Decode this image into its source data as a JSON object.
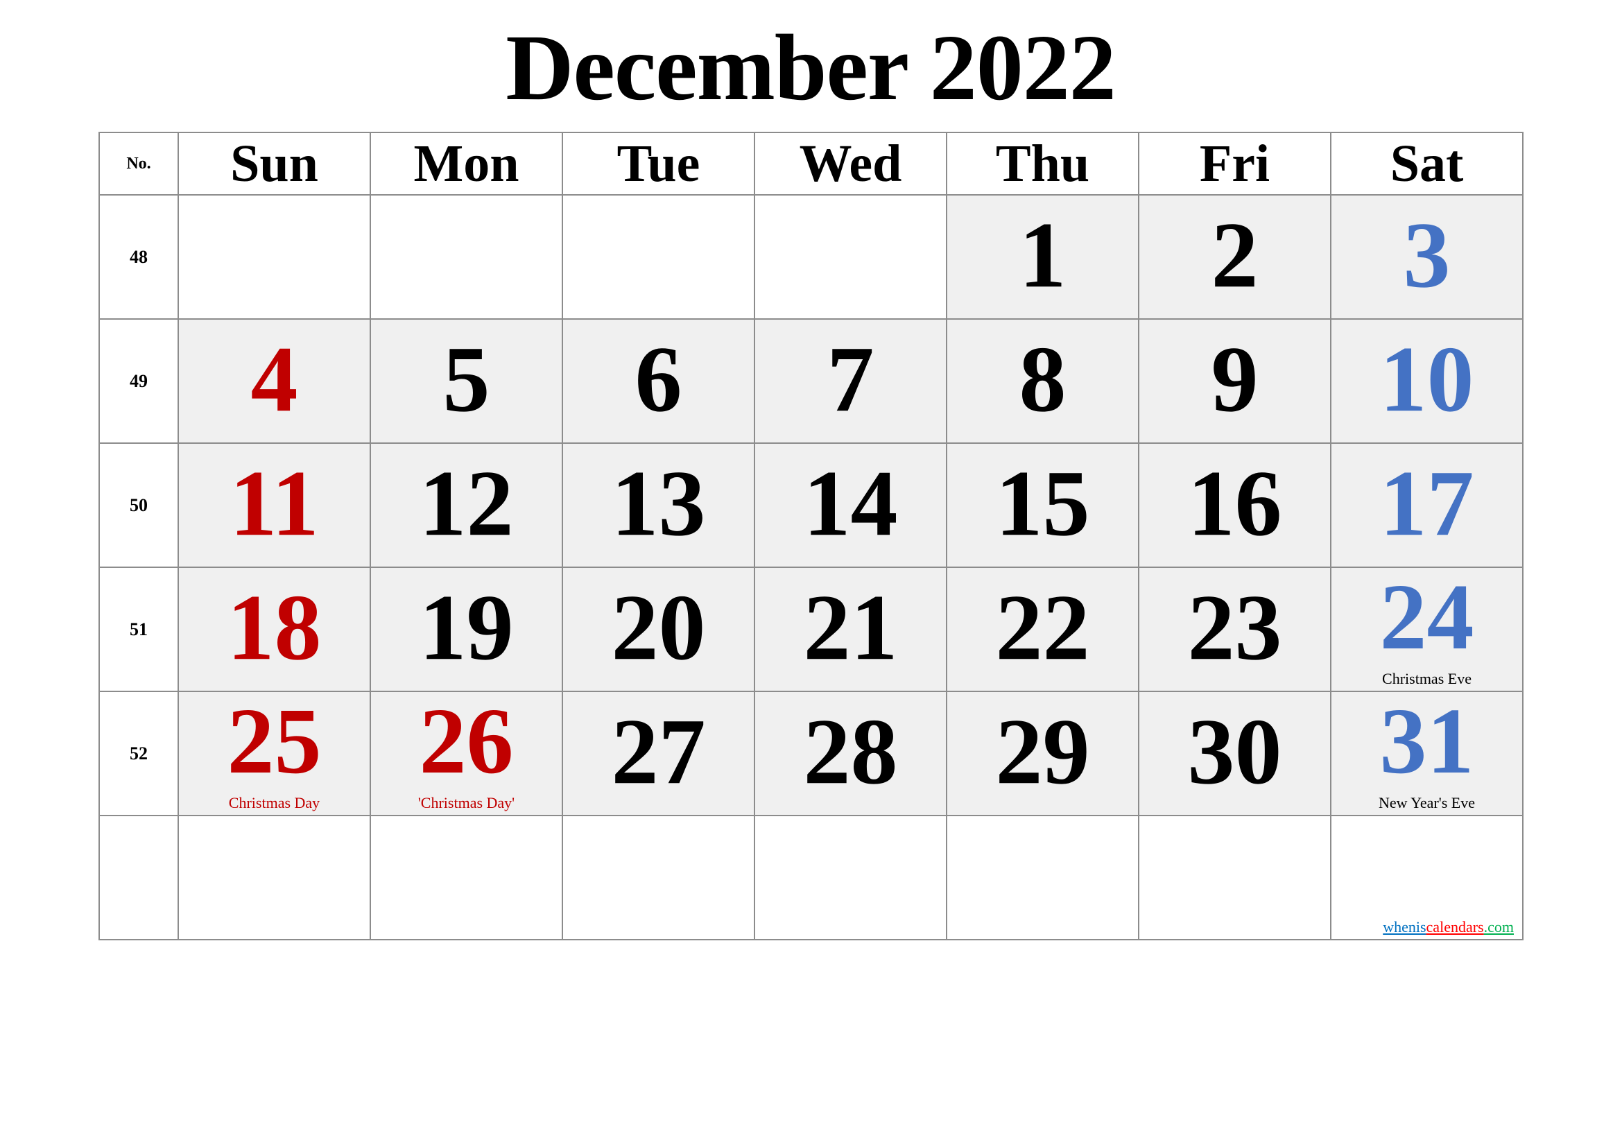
{
  "title": "December 2022",
  "header": {
    "week_no_label": "No.",
    "days": [
      "Sun",
      "Mon",
      "Tue",
      "Wed",
      "Thu",
      "Fri",
      "Sat"
    ]
  },
  "colors": {
    "sunday_holiday": "#C00000",
    "saturday": "#4472C4",
    "weekday": "#000000",
    "cell_fill": "#F0F0F0",
    "grid": "#8C8C8C"
  },
  "weeks": [
    {
      "no": "48",
      "days": [
        {
          "day": "",
          "color": "black",
          "holiday": ""
        },
        {
          "day": "",
          "color": "black",
          "holiday": ""
        },
        {
          "day": "",
          "color": "black",
          "holiday": ""
        },
        {
          "day": "",
          "color": "black",
          "holiday": ""
        },
        {
          "day": "1",
          "color": "black",
          "holiday": ""
        },
        {
          "day": "2",
          "color": "black",
          "holiday": ""
        },
        {
          "day": "3",
          "color": "blue",
          "holiday": ""
        }
      ]
    },
    {
      "no": "49",
      "days": [
        {
          "day": "4",
          "color": "red",
          "holiday": ""
        },
        {
          "day": "5",
          "color": "black",
          "holiday": ""
        },
        {
          "day": "6",
          "color": "black",
          "holiday": ""
        },
        {
          "day": "7",
          "color": "black",
          "holiday": ""
        },
        {
          "day": "8",
          "color": "black",
          "holiday": ""
        },
        {
          "day": "9",
          "color": "black",
          "holiday": ""
        },
        {
          "day": "10",
          "color": "blue",
          "holiday": ""
        }
      ]
    },
    {
      "no": "50",
      "days": [
        {
          "day": "11",
          "color": "red",
          "holiday": ""
        },
        {
          "day": "12",
          "color": "black",
          "holiday": ""
        },
        {
          "day": "13",
          "color": "black",
          "holiday": ""
        },
        {
          "day": "14",
          "color": "black",
          "holiday": ""
        },
        {
          "day": "15",
          "color": "black",
          "holiday": ""
        },
        {
          "day": "16",
          "color": "black",
          "holiday": ""
        },
        {
          "day": "17",
          "color": "blue",
          "holiday": ""
        }
      ]
    },
    {
      "no": "51",
      "days": [
        {
          "day": "18",
          "color": "red",
          "holiday": ""
        },
        {
          "day": "19",
          "color": "black",
          "holiday": ""
        },
        {
          "day": "20",
          "color": "black",
          "holiday": ""
        },
        {
          "day": "21",
          "color": "black",
          "holiday": ""
        },
        {
          "day": "22",
          "color": "black",
          "holiday": ""
        },
        {
          "day": "23",
          "color": "black",
          "holiday": ""
        },
        {
          "day": "24",
          "color": "blue",
          "holiday": "Christmas Eve",
          "holiday_color": "black"
        }
      ]
    },
    {
      "no": "52",
      "days": [
        {
          "day": "25",
          "color": "red",
          "holiday": "Christmas Day",
          "holiday_color": "red"
        },
        {
          "day": "26",
          "color": "red",
          "holiday": "'Christmas Day'",
          "holiday_color": "red"
        },
        {
          "day": "27",
          "color": "black",
          "holiday": ""
        },
        {
          "day": "28",
          "color": "black",
          "holiday": ""
        },
        {
          "day": "29",
          "color": "black",
          "holiday": ""
        },
        {
          "day": "30",
          "color": "black",
          "holiday": ""
        },
        {
          "day": "31",
          "color": "blue",
          "holiday": "New Year's Eve",
          "holiday_color": "black"
        }
      ]
    },
    {
      "no": "",
      "days": [
        {
          "day": "",
          "color": "black",
          "holiday": ""
        },
        {
          "day": "",
          "color": "black",
          "holiday": ""
        },
        {
          "day": "",
          "color": "black",
          "holiday": ""
        },
        {
          "day": "",
          "color": "black",
          "holiday": ""
        },
        {
          "day": "",
          "color": "black",
          "holiday": ""
        },
        {
          "day": "",
          "color": "black",
          "holiday": ""
        },
        {
          "day": "",
          "color": "black",
          "holiday": ""
        }
      ]
    }
  ],
  "watermark": {
    "part1": "whenis",
    "part2": "calendars",
    "part3": ".com"
  }
}
